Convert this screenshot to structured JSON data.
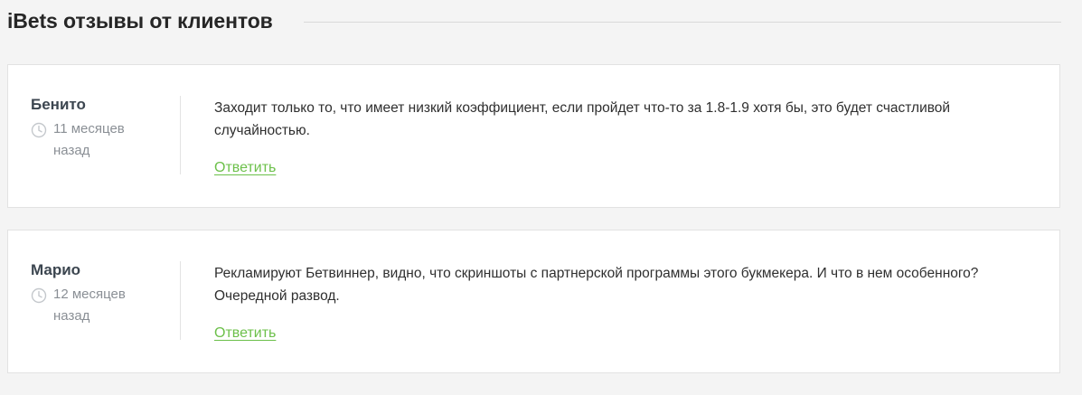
{
  "header": {
    "title": "iBets отзывы от клиентов"
  },
  "reviews": [
    {
      "author": "Бенито",
      "date": "11 месяцев назад",
      "text": "Заходит только то, что имеет низкий коэффициент, если пройдет что-то за 1.8-1.9 хотя бы, это будет счастливой случайностью.",
      "reply_label": "Ответить"
    },
    {
      "author": "Марио",
      "date": "12 месяцев назад",
      "text": "Рекламируют Бетвиннер, видно, что скриншоты с партнерской программы этого букмекера. И что в нем особенного? Очередной развод.",
      "reply_label": "Ответить"
    }
  ],
  "icons": {
    "date": "clock-icon"
  },
  "colors": {
    "accent": "#6cc04a",
    "text_muted": "#8a8f95",
    "author": "#3c4650",
    "background": "#f4f4f4"
  }
}
